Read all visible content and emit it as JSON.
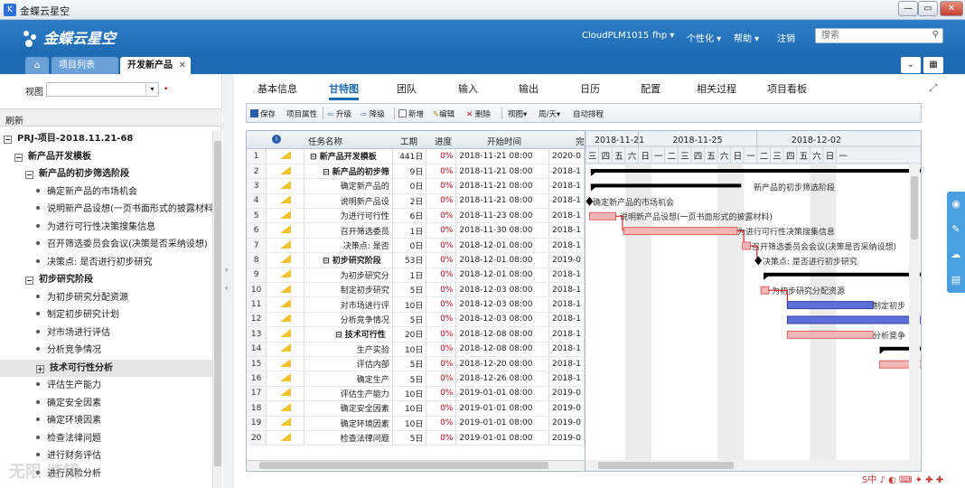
{
  "window": {
    "title": "金蝶云星空",
    "min": "—",
    "max": "▭",
    "close": "✕"
  },
  "header": {
    "logo": "金蝶云星空",
    "items": [
      {
        "label": "CloudPLM1015"
      },
      {
        "label": "fhp ▾"
      },
      {
        "label": "个性化 ▾"
      },
      {
        "label": "帮助 ▾"
      },
      {
        "label": "注销"
      }
    ],
    "search_placeholder": "搜索"
  },
  "tabs": {
    "home": "⌂",
    "list": "项目列表",
    "active": "开发新产品",
    "close": "✕"
  },
  "left": {
    "view_label": "视图",
    "refresh": "刷新",
    "tree": [
      {
        "label": "PRJ-项目-2018.11.21-68",
        "level": 0,
        "exp": "−",
        "bold": true
      },
      {
        "label": "新产品开发模板",
        "level": 1,
        "exp": "−",
        "bold": true
      },
      {
        "label": "新产品的初步筛选阶段",
        "level": 2,
        "exp": "−",
        "bold": true
      },
      {
        "label": "确定新产品的市场机会",
        "level": 3
      },
      {
        "label": "说明新产品设想(一页书面形式的披露材料)",
        "level": 3
      },
      {
        "label": "为进行可行性决策搜集信息",
        "level": 3
      },
      {
        "label": "召开筛选委员会会议(决策是否采纳设想)",
        "level": 3
      },
      {
        "label": "决策点: 是否进行初步研究",
        "level": 3
      },
      {
        "label": "初步研究阶段",
        "level": 2,
        "exp": "−",
        "bold": true
      },
      {
        "label": "为初步研究分配资源",
        "level": 3
      },
      {
        "label": "制定初步研究计划",
        "level": 3
      },
      {
        "label": "对市场进行评估",
        "level": 3
      },
      {
        "label": "分析竞争情况",
        "level": 3
      },
      {
        "label": "技术可行性分析",
        "level": 3,
        "exp": "+",
        "bold": true,
        "sel": true
      },
      {
        "label": "评估生产能力",
        "level": 3
      },
      {
        "label": "确定安全因素",
        "level": 3
      },
      {
        "label": "确定环境因素",
        "level": 3
      },
      {
        "label": "检查法律问题",
        "level": 3
      },
      {
        "label": "进行财务评估",
        "level": 3
      },
      {
        "label": "进行风险分析",
        "level": 3
      }
    ]
  },
  "main_tabs": [
    "基本信息",
    "甘特图",
    "团队",
    "输入",
    "输出",
    "日历",
    "配置",
    "相关过程",
    "项目看板"
  ],
  "toolbar": [
    "保存",
    "项目属性",
    "升级",
    "降级",
    "新增",
    "编辑",
    "删除",
    "视图▾",
    "周/天▾",
    "自动排程"
  ],
  "grid": {
    "headers": [
      "",
      "",
      "任务名称",
      "工期",
      "进度",
      "开始时间",
      "完"
    ],
    "rows": [
      {
        "no": "1",
        "name": "⊟ 新产品开发模板",
        "dur": "441日",
        "pct": "0%",
        "start": "2018-11-21 08:00",
        "end": "2020-0",
        "bold": true,
        "indent": 0
      },
      {
        "no": "2",
        "name": "⊟ 新产品的初步筛",
        "dur": "9日",
        "pct": "0%",
        "start": "2018-11-21 08:00",
        "end": "2018-1",
        "bold": true,
        "indent": 1
      },
      {
        "no": "3",
        "name": "确定新产品的",
        "dur": "0日",
        "pct": "0%",
        "start": "2018-11-21 08:00",
        "end": "2018-1",
        "indent": 2
      },
      {
        "no": "4",
        "name": "说明新产品设",
        "dur": "2日",
        "pct": "0%",
        "start": "2018-11-21 08:00",
        "end": "2018-1",
        "indent": 2
      },
      {
        "no": "5",
        "name": "为进行可行性",
        "dur": "6日",
        "pct": "0%",
        "start": "2018-11-23 08:00",
        "end": "2018-1",
        "indent": 2
      },
      {
        "no": "6",
        "name": "召开筛选委员",
        "dur": "1日",
        "pct": "0%",
        "start": "2018-11-30 08:00",
        "end": "2018-1",
        "indent": 2
      },
      {
        "no": "7",
        "name": "决策点: 是否",
        "dur": "0日",
        "pct": "0%",
        "start": "2018-12-01 08:00",
        "end": "2018-1",
        "indent": 2
      },
      {
        "no": "8",
        "name": "⊟ 初步研究阶段",
        "dur": "53日",
        "pct": "0%",
        "start": "2018-12-01 08:00",
        "end": "2019-0",
        "bold": true,
        "indent": 1
      },
      {
        "no": "9",
        "name": "为初步研究分",
        "dur": "1日",
        "pct": "0%",
        "start": "2018-12-01 08:00",
        "end": "2018-1",
        "indent": 2
      },
      {
        "no": "10",
        "name": "制定初步研究",
        "dur": "5日",
        "pct": "0%",
        "start": "2018-12-03 08:00",
        "end": "2018-1",
        "indent": 2
      },
      {
        "no": "11",
        "name": "对市场进行评",
        "dur": "10日",
        "pct": "0%",
        "start": "2018-12-03 08:00",
        "end": "2018-1",
        "indent": 2
      },
      {
        "no": "12",
        "name": "分析竞争情况",
        "dur": "5日",
        "pct": "0%",
        "start": "2018-12-03 08:00",
        "end": "2018-1",
        "indent": 2
      },
      {
        "no": "13",
        "name": "⊟ 技术可行性",
        "dur": "20日",
        "pct": "0%",
        "start": "2018-12-08 08:00",
        "end": "2018-1",
        "bold": true,
        "indent": 2
      },
      {
        "no": "14",
        "name": "生产实验",
        "dur": "10日",
        "pct": "0%",
        "start": "2018-12-08 08:00",
        "end": "2018-1",
        "indent": 3
      },
      {
        "no": "15",
        "name": "评估内部",
        "dur": "5日",
        "pct": "0%",
        "start": "2018-12-20 08:00",
        "end": "2018-1",
        "indent": 3
      },
      {
        "no": "16",
        "name": "确定生产",
        "dur": "5日",
        "pct": "0%",
        "start": "2018-12-26 08:00",
        "end": "2018-1",
        "indent": 3
      },
      {
        "no": "17",
        "name": "评估生产能力",
        "dur": "10日",
        "pct": "0%",
        "start": "2019-01-01 08:00",
        "end": "2019-0",
        "indent": 2
      },
      {
        "no": "18",
        "name": "确定安全因素",
        "dur": "10日",
        "pct": "0%",
        "start": "2019-01-01 08:00",
        "end": "2019-0",
        "indent": 2
      },
      {
        "no": "19",
        "name": "确定环境因素",
        "dur": "10日",
        "pct": "0%",
        "start": "2019-01-01 08:00",
        "end": "2019-0",
        "indent": 2
      },
      {
        "no": "20",
        "name": "检查法律问题",
        "dur": "5日",
        "pct": "0%",
        "start": "2019-01-01 08:00",
        "end": "2019-0",
        "indent": 2
      }
    ]
  },
  "gantt": {
    "weeks": [
      "2018-11-21",
      "2018-11-25",
      "2018-12-02"
    ],
    "days": [
      "三",
      "四",
      "五",
      "六",
      "日",
      "一",
      "二",
      "三",
      "四",
      "五",
      "六",
      "日",
      "一",
      "二",
      "三",
      "四",
      "五",
      "六",
      "日",
      "一"
    ],
    "labels": [
      "新产品的初步筛选阶段",
      "确定新产品的市场机会",
      "说明新产品设想(一页书面形式的披露材料)",
      "为进行可行性决策搜集信息",
      "召开筛选委员会会议(决策是否采纳设想)",
      "决策点: 是否进行初步研究",
      "为初步研究分配资源",
      "制定初步",
      "分析竞争"
    ],
    "colors": {
      "summary": "#000000",
      "task": "#e06060",
      "task_fill": "#f3b7b7",
      "blue": "#5b6fd6",
      "link": "#cc0000"
    }
  },
  "float": [
    "◉",
    "✎",
    "☁",
    "▤"
  ],
  "ime": "S中 ♪ ◐ ⌨ ✦ ✚ ✚",
  "watermark": "无限 览镜"
}
